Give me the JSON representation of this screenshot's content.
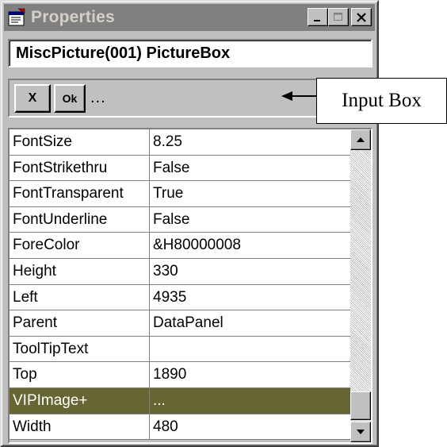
{
  "window": {
    "title": "Properties",
    "icon": "properties-icon",
    "controls": {
      "minimize_icon": "minimize-icon",
      "maximize_icon": "maximize-icon",
      "close_icon": "close-icon"
    }
  },
  "object_selector": {
    "value": "MiscPicture(001) PictureBox"
  },
  "input_row": {
    "cancel_label": "X",
    "ok_label": "Ok",
    "value": "..."
  },
  "annotation": {
    "label": "Input Box"
  },
  "properties": [
    {
      "name": "FontSize",
      "value": "8.25"
    },
    {
      "name": "FontStrikethru",
      "value": "False"
    },
    {
      "name": "FontTransparent",
      "value": "True"
    },
    {
      "name": "FontUnderline",
      "value": "False"
    },
    {
      "name": "ForeColor",
      "value": "&H80000008"
    },
    {
      "name": "Height",
      "value": "330"
    },
    {
      "name": "Left",
      "value": "4935"
    },
    {
      "name": "Parent",
      "value": "DataPanel"
    },
    {
      "name": "ToolTipText",
      "value": ""
    },
    {
      "name": "Top",
      "value": "1890"
    },
    {
      "name": "VIPImage+",
      "value": "..."
    },
    {
      "name": "Width",
      "value": "480"
    }
  ],
  "selected_property": "VIPImage+",
  "colors": {
    "titlebar_inactive": "#808080",
    "selected_row": "#666633",
    "window_face": "#c0c0c0"
  }
}
